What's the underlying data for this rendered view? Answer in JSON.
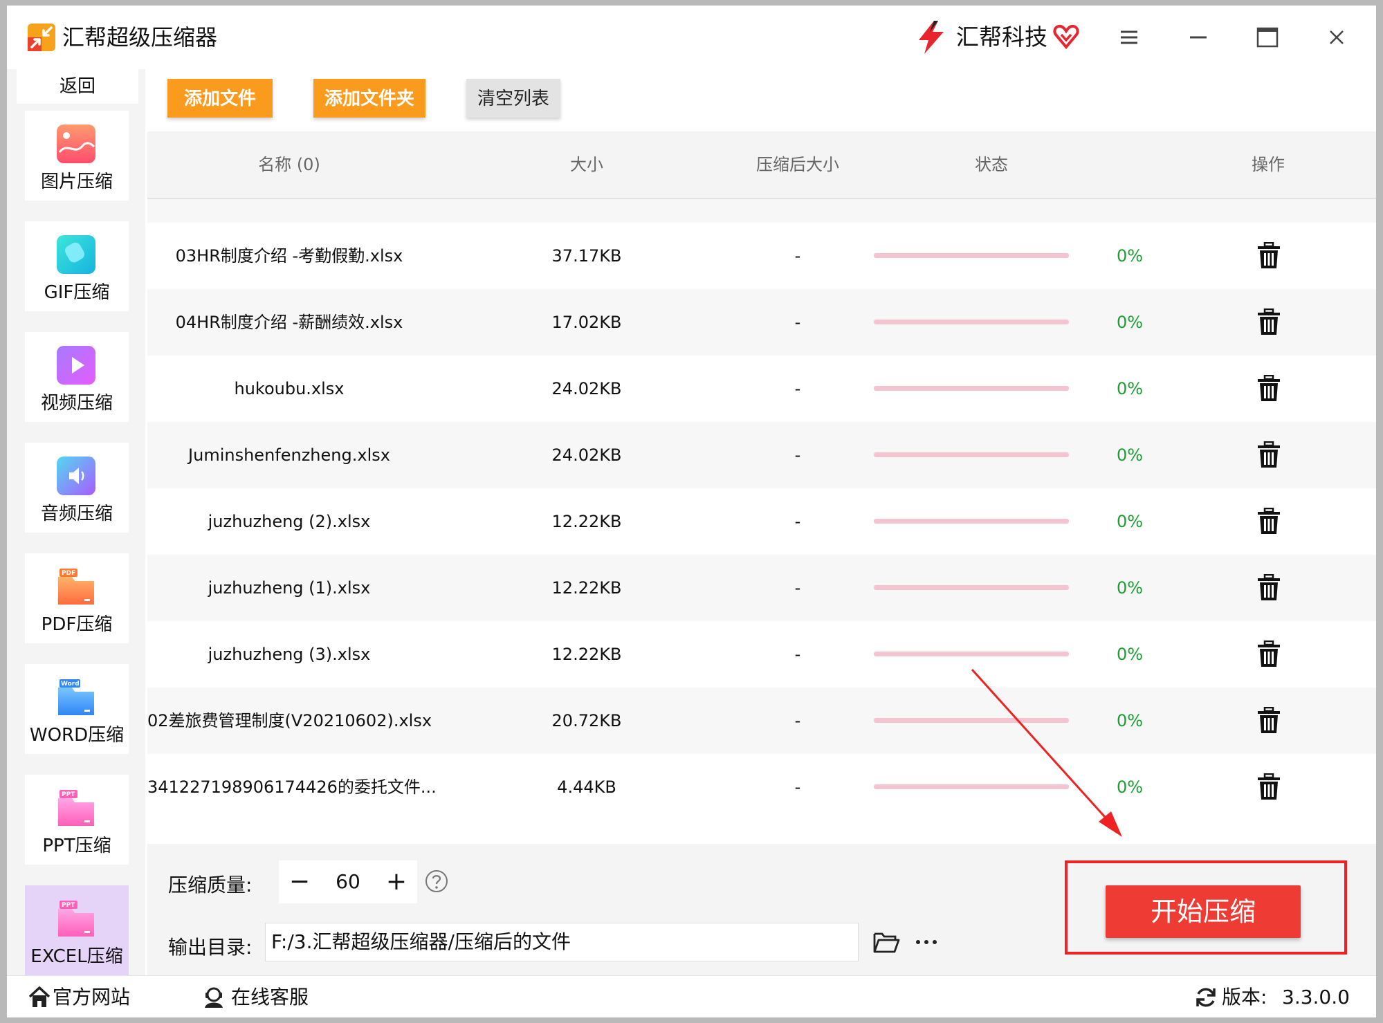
{
  "app": {
    "title": "汇帮超级压缩器",
    "brand": "汇帮科技"
  },
  "sidebar": {
    "back": "返回",
    "items": [
      {
        "label": "图片压缩",
        "icon": "image-icon"
      },
      {
        "label": "GIF压缩",
        "icon": "gif-icon"
      },
      {
        "label": "视频压缩",
        "icon": "video-icon"
      },
      {
        "label": "音频压缩",
        "icon": "audio-icon"
      },
      {
        "label": "PDF压缩",
        "icon": "pdf-file-icon"
      },
      {
        "label": "WORD压缩",
        "icon": "word-file-icon"
      },
      {
        "label": "PPT压缩",
        "icon": "ppt-file-icon"
      },
      {
        "label": "EXCEL压缩",
        "icon": "excel-file-icon"
      }
    ],
    "badges": {
      "pdf": "PDF",
      "word": "Word",
      "ppt": "PPT",
      "excel": "PPT"
    }
  },
  "toolbar": {
    "add_file": "添加文件",
    "add_folder": "添加文件夹",
    "clear_list": "清空列表"
  },
  "table": {
    "headers": {
      "name": "名称 (0)",
      "size": "大小",
      "compressed_size": "压缩后大小",
      "status": "状态",
      "action": "操作"
    },
    "rows": [
      {
        "name": "03HR制度介绍 -考勤假勤.xlsx",
        "size": "37.17KB",
        "compressed": "-",
        "progress": 0,
        "percent": "0%"
      },
      {
        "name": "04HR制度介绍 -薪酬绩效.xlsx",
        "size": "17.02KB",
        "compressed": "-",
        "progress": 0,
        "percent": "0%"
      },
      {
        "name": "hukoubu.xlsx",
        "size": "24.02KB",
        "compressed": "-",
        "progress": 0,
        "percent": "0%"
      },
      {
        "name": "Juminshenfenzheng.xlsx",
        "size": "24.02KB",
        "compressed": "-",
        "progress": 0,
        "percent": "0%"
      },
      {
        "name": "juzhuzheng (2).xlsx",
        "size": "12.22KB",
        "compressed": "-",
        "progress": 0,
        "percent": "0%"
      },
      {
        "name": "juzhuzheng (1).xlsx",
        "size": "12.22KB",
        "compressed": "-",
        "progress": 0,
        "percent": "0%"
      },
      {
        "name": "juzhuzheng (3).xlsx",
        "size": "12.22KB",
        "compressed": "-",
        "progress": 0,
        "percent": "0%"
      },
      {
        "name": "02差旅费管理制度(V20210602).xlsx",
        "size": "20.72KB",
        "compressed": "-",
        "progress": 0,
        "percent": "0%"
      },
      {
        "name": "341227198906174426的委托文件...",
        "size": "4.44KB",
        "compressed": "-",
        "progress": 0,
        "percent": "0%"
      }
    ]
  },
  "settings": {
    "quality_label": "压缩质量:",
    "quality_value": "60",
    "minus": "−",
    "plus": "+",
    "output_label": "输出目录:",
    "output_path": "F:/3.汇帮超级压缩器/压缩后的文件",
    "start": "开始压缩"
  },
  "footer": {
    "website": "官方网站",
    "support": "在线客服",
    "version_label": "版本:",
    "version": "3.3.0.0"
  },
  "colors": {
    "accent_orange": "#fa9b1e",
    "start_red": "#ee3b33",
    "percent_green": "#19a130",
    "progress_pink": "#f5c4d1"
  }
}
